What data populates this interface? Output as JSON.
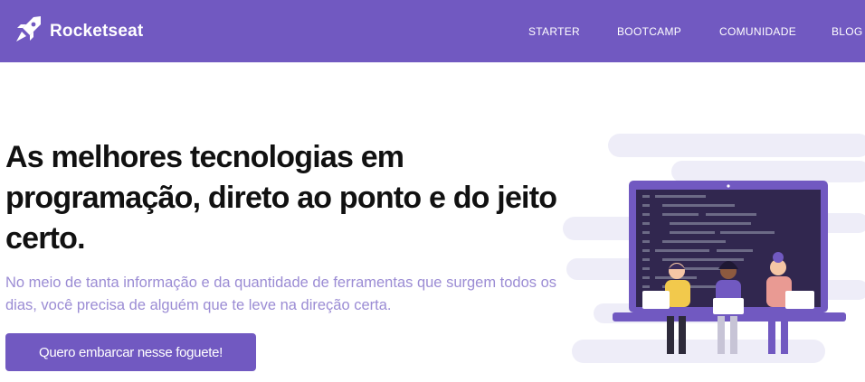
{
  "header": {
    "brand": "Rocketseat",
    "nav": [
      {
        "label": "STARTER"
      },
      {
        "label": "BOOTCAMP"
      },
      {
        "label": "COMUNIDADE"
      },
      {
        "label": "BLOG"
      }
    ]
  },
  "hero": {
    "title": "As melhores tecnologias em programação, direto ao ponto e do jeito certo.",
    "subtitle": "No meio de tanta informação e da quantidade de ferramentas que surgem todos os dias, você precisa de alguém que te leve na direção certa.",
    "cta_label": "Quero embarcar nesse foguete!"
  },
  "icons": {
    "logo": "rocket-icon"
  },
  "colors": {
    "brand": "#7159c1",
    "subtitle": "#9b8cd4",
    "background": "#ffffff"
  }
}
